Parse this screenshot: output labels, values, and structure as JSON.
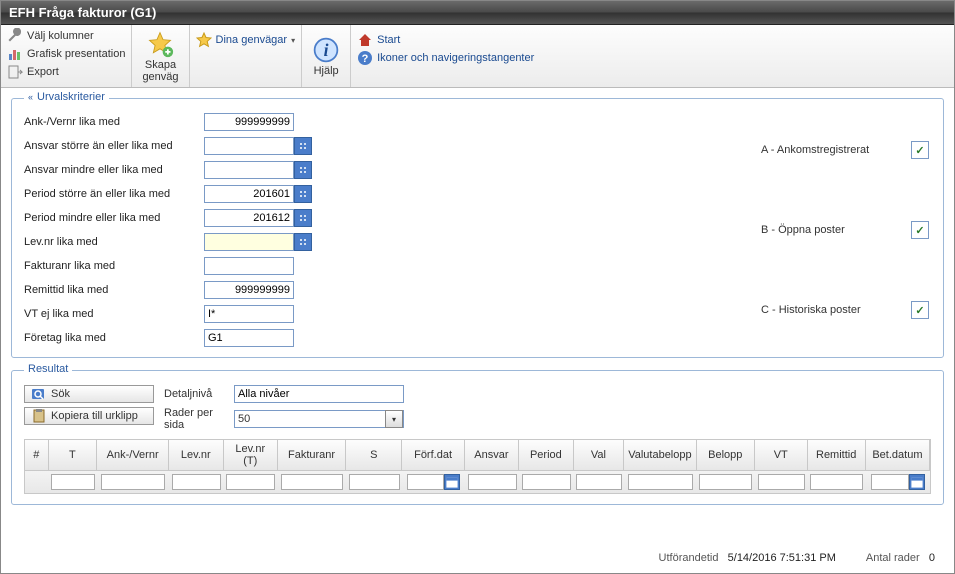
{
  "window": {
    "title": "EFH Fråga fakturor (G1)"
  },
  "toolbar": {
    "valj_kolumner": "Välj kolumner",
    "grafisk": "Grafisk presentation",
    "export": "Export",
    "skapa_genvag": "Skapa\ngenväg",
    "dina_genvagar": "Dina genvägar",
    "hjalp": "Hjälp",
    "start": "Start",
    "ikoner": "Ikoner och navigeringstangenter"
  },
  "criteria": {
    "legend": "Urvalskriterier",
    "rows": [
      {
        "label": "Ank-/Vernr lika med",
        "value": "999999999",
        "lookup": false,
        "align": "right"
      },
      {
        "label": "Ansvar större än eller lika med",
        "value": "",
        "lookup": true,
        "align": "left"
      },
      {
        "label": "Ansvar mindre eller lika med",
        "value": "",
        "lookup": true,
        "align": "left"
      },
      {
        "label": "Period större än eller lika med",
        "value": "201601",
        "lookup": true,
        "align": "right"
      },
      {
        "label": "Period mindre eller lika med",
        "value": "201612",
        "lookup": true,
        "align": "right"
      },
      {
        "label": "Lev.nr lika med",
        "value": "",
        "lookup": true,
        "align": "left",
        "hl": true
      },
      {
        "label": "Fakturanr lika med",
        "value": "",
        "lookup": false,
        "align": "left"
      },
      {
        "label": "Remittid lika med",
        "value": "999999999",
        "lookup": false,
        "align": "right"
      },
      {
        "label": "VT ej lika med",
        "value": "I*",
        "lookup": false,
        "align": "left"
      },
      {
        "label": "Företag lika med",
        "value": "G1",
        "lookup": false,
        "align": "left"
      }
    ],
    "checks": [
      {
        "label": "A - Ankomstregistrerat",
        "checked": true
      },
      {
        "label": "B - Öppna poster",
        "checked": true
      },
      {
        "label": "C - Historiska poster",
        "checked": true
      }
    ]
  },
  "result": {
    "legend": "Resultat",
    "sok": "Sök",
    "kopiera": "Kopiera till urklipp",
    "detaljniva_label": "Detaljnivå",
    "detaljniva_value": "Alla nivåer",
    "rader_label": "Rader per sida",
    "rader_value": "50",
    "columns": [
      "#",
      "T",
      "Ank-/Vernr",
      "Lev.nr",
      "Lev.nr (T)",
      "Fakturanr",
      "S",
      "Förf.dat",
      "Ansvar",
      "Period",
      "Val",
      "Valutabelopp",
      "Belopp",
      "VT",
      "Remittid",
      "Bet.datum"
    ]
  },
  "status": {
    "utf_label": "Utförandetid",
    "utf_value": "5/14/2016 7:51:31 PM",
    "rader_label": "Antal rader",
    "rader_value": "0"
  }
}
